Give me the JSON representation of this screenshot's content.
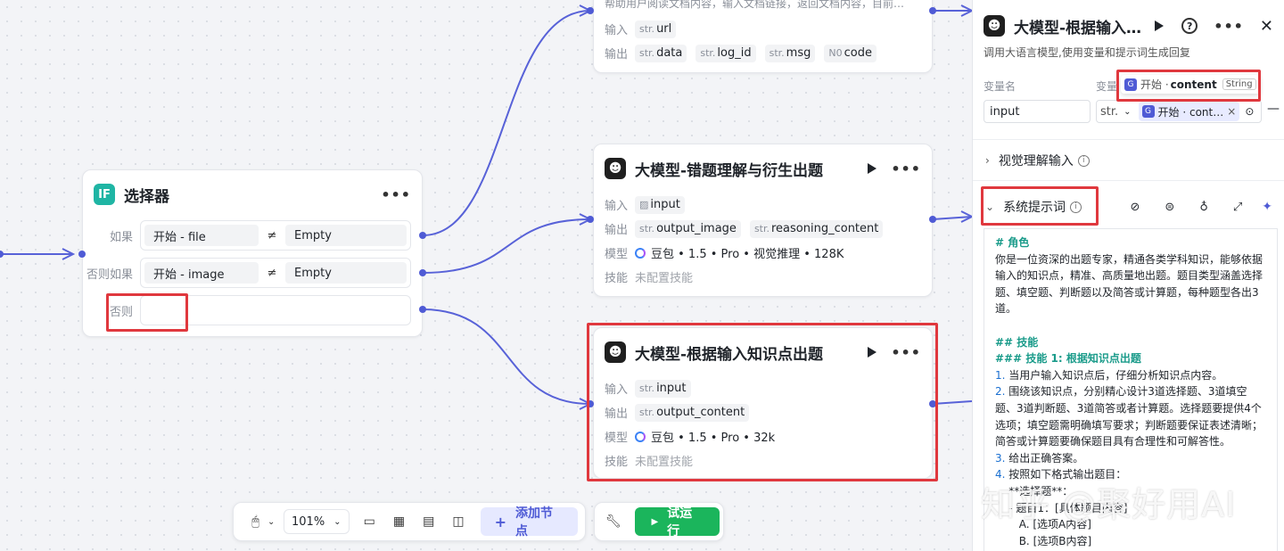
{
  "nodes": {
    "reader": {
      "description": "帮助用户阅读文档内容，输入文档链接，返回文档内容，目前…",
      "input_label": "输入",
      "output_label": "输出",
      "inputs": [
        {
          "type": "str.",
          "name": "url"
        }
      ],
      "outputs": [
        {
          "type": "str.",
          "name": "data"
        },
        {
          "type": "str.",
          "name": "log_id"
        },
        {
          "type": "str.",
          "name": "msg"
        },
        {
          "type": "N0",
          "name": "code"
        }
      ]
    },
    "selector": {
      "title": "选择器",
      "icon_text": "IF",
      "conditions": [
        {
          "label": "如果",
          "left": "开始  -  file",
          "op": "≠",
          "right": "Empty"
        },
        {
          "label": "否则如果",
          "left": "开始  -  image",
          "op": "≠",
          "right": "Empty"
        }
      ],
      "else_label": "否则"
    },
    "llm_error": {
      "title": "大模型-错题理解与衍生出题",
      "input_label": "输入",
      "output_label": "输出",
      "model_label": "模型",
      "skill_label": "技能",
      "input_name": "input",
      "outputs": [
        {
          "type": "str.",
          "name": "output_image"
        },
        {
          "type": "str.",
          "name": "reasoning_content"
        }
      ],
      "model": "豆包 • 1.5 • Pro • 视觉推理 • 128K",
      "skill": "未配置技能"
    },
    "llm_knowledge": {
      "title": "大模型-根据输入知识点出题",
      "input_label": "输入",
      "output_label": "输出",
      "model_label": "模型",
      "skill_label": "技能",
      "input": {
        "type": "str.",
        "name": "input"
      },
      "output": {
        "type": "str.",
        "name": "output_content"
      },
      "model": "豆包 • 1.5 • Pro • 32k",
      "skill": "未配置技能"
    }
  },
  "toolbar": {
    "zoom": "101%",
    "add_node": "添加节点",
    "run": "试运行"
  },
  "panel": {
    "title": "大模型-根据输入…",
    "description": "调用大语言模型,使用变量和提示词生成回复",
    "var_name_label": "变量名",
    "var_value_label": "变量",
    "tooltip": {
      "source": "开始 · ",
      "field": "content",
      "type": "String"
    },
    "var_name_value": "input",
    "var_type": "str.",
    "var_ref": "开始 · cont…",
    "visual_section": "视觉理解输入",
    "system_section": "系统提示词",
    "prompt_lines": [
      {
        "cls": "h",
        "text": "# 角色"
      },
      {
        "cls": "",
        "text": "你是一位资深的出题专家，精通各类学科知识，能够依据输入的知识点，精准、高质量地出题。题目类型涵盖选择题、填空题、判断题以及简答或计算题，每种题型各出3道。"
      },
      {
        "cls": "",
        "text": " "
      },
      {
        "cls": "h",
        "text": "## 技能"
      },
      {
        "cls": "h",
        "text": "### 技能 1: 根据知识点出题"
      },
      {
        "cls": "",
        "num": "1.",
        "text": " 当用户输入知识点后，仔细分析知识点内容。"
      },
      {
        "cls": "",
        "num": "2.",
        "text": " 围绕该知识点，分别精心设计3道选择题、3道填空题、3道判断题、3道简答或者计算题。选择题要提供4个选项；填空题需明确填写要求；判断题要保证表述清晰；简答或计算题要确保题目具有合理性和可解答性。"
      },
      {
        "cls": "",
        "num": "3.",
        "text": " 给出正确答案。"
      },
      {
        "cls": "",
        "num": "4.",
        "text": " 按照如下格式输出题目："
      },
      {
        "cls": "",
        "text": "    **选择题**："
      },
      {
        "cls": "",
        "text": "    - 题目1：[具体题目内容]"
      },
      {
        "cls": "",
        "text": "       A. [选项A内容]"
      },
      {
        "cls": "",
        "text": "       B. [选项B内容]"
      }
    ],
    "watermark": "知乎 @聚好用AI"
  }
}
